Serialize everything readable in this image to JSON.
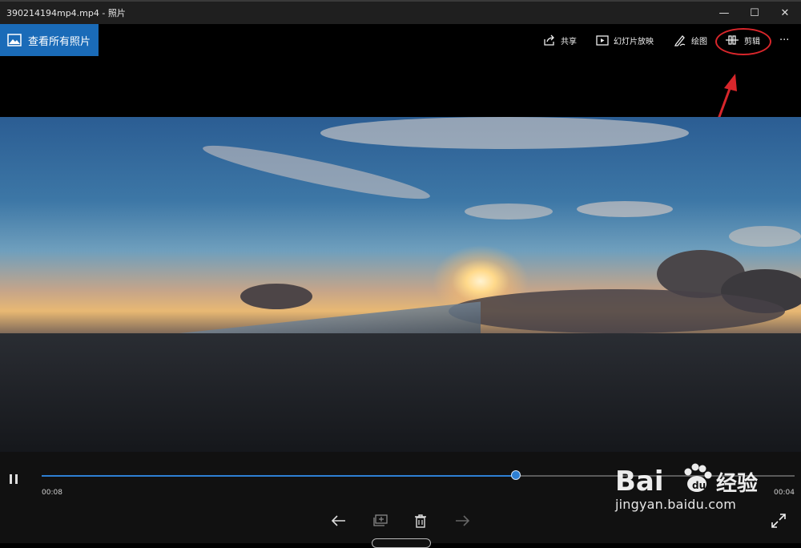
{
  "window": {
    "title": "390214194mp4.mp4 - 照片",
    "minimize_glyph": "—",
    "maximize_glyph": "☐",
    "close_glyph": "✕"
  },
  "toolbar": {
    "view_all_label": "查看所有照片",
    "share_label": "共享",
    "slideshow_label": "幻灯片放映",
    "draw_label": "绘图",
    "edit_label": "剪辑",
    "more_glyph": "···",
    "icons": {
      "view_all": "photos-icon",
      "share": "share-icon",
      "slideshow": "slideshow-icon",
      "draw": "pen-icon",
      "edit": "trim-icon"
    }
  },
  "annotation": {
    "highlight_color": "#d8262b"
  },
  "player": {
    "current_time": "00:08",
    "remaining_time": "00:04",
    "progress_fraction": 0.63,
    "accent_color": "#2d7fd3"
  },
  "watermark": {
    "brand": "Bai 经验",
    "url": "jingyan.baidu.com"
  }
}
